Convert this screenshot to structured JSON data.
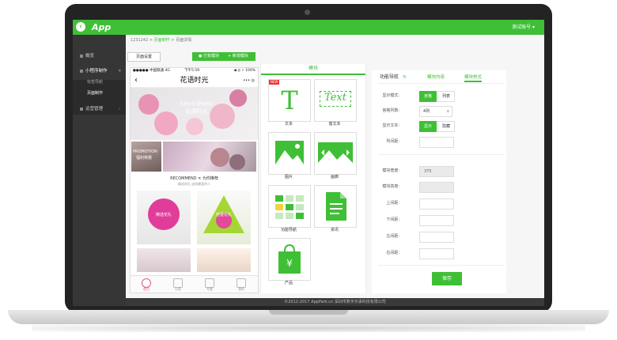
{
  "topbar": {
    "logo": "App",
    "account": "测试账号 ▾"
  },
  "breadcrumb": {
    "id": "1231242",
    "sep1": ">",
    "item1": "页面制作",
    "sep2": ">",
    "item2": "页面详情"
  },
  "sidebar": {
    "items": [
      {
        "label": "概览"
      },
      {
        "label": "小程序制作",
        "arrow": "▾"
      },
      {
        "label": "运营管理",
        "arrow": "›"
      }
    ],
    "sub_items": [
      {
        "label": "标签导航"
      },
      {
        "label": "页面制作"
      }
    ]
  },
  "toolbar": {
    "page_settings": "页面设置",
    "existing_blocks": "● 已有模块",
    "add_block": "+ 新增模块"
  },
  "phone": {
    "status_left": "●●●●● 中国联通  4G",
    "status_center": "下午5:59",
    "status_right": "◀ ◎ ⚡ 100%",
    "title": "花语时光",
    "back": "‹",
    "menu": "••• ◎",
    "banner_text": "生若有花 便有美好",
    "banner_sub": "花语时光",
    "promo_text": "PROMOTION",
    "promo_sub": "福利特惠",
    "rec_title": "RECOMMEND ✕ 为你推荐",
    "rec_sub": "精选花礼 送给最爱的人",
    "card1_text": "精选花礼",
    "card2_text": "桔梗花礼",
    "tabs": [
      {
        "label": "首页"
      },
      {
        "label": "分类"
      },
      {
        "label": "专题"
      },
      {
        "label": "我的"
      }
    ]
  },
  "blocks": {
    "title": "模块",
    "new_badge": "NEW",
    "tiles": [
      {
        "label": "文本"
      },
      {
        "label": "富文本"
      },
      {
        "label": "图片"
      },
      {
        "label": "画廊"
      },
      {
        "label": "功能导航"
      },
      {
        "label": "资讯"
      },
      {
        "label": "产品"
      }
    ],
    "text_glyph": "T",
    "richtext_glyph": "Text"
  },
  "settings": {
    "title": "功能导航",
    "tab_content": "模块内容",
    "tab_style": "模块样式",
    "display_mode_label": "显示模式:",
    "mode_grid": "宫格",
    "mode_list": "列表",
    "columns_label": "宫格列数:",
    "columns_value": "4列",
    "show_text_label": "显示文本:",
    "show": "显示",
    "hide": "隐藏",
    "col_gap_label": "列间距:",
    "width_label": "模块宽度:",
    "width_value": "375",
    "height_label": "模块高度:",
    "top_label": "上间距:",
    "bottom_label": "下间距:",
    "left_label": "左间距:",
    "right_label": "右间距:",
    "save": "保存"
  },
  "footer": {
    "text": "©2012-2017 AppPark.cn 深圳市数字天承科技有限公司"
  },
  "colors": {
    "accent": "#3fbf36",
    "sidebar": "#363636",
    "pink": "#e4588b"
  }
}
